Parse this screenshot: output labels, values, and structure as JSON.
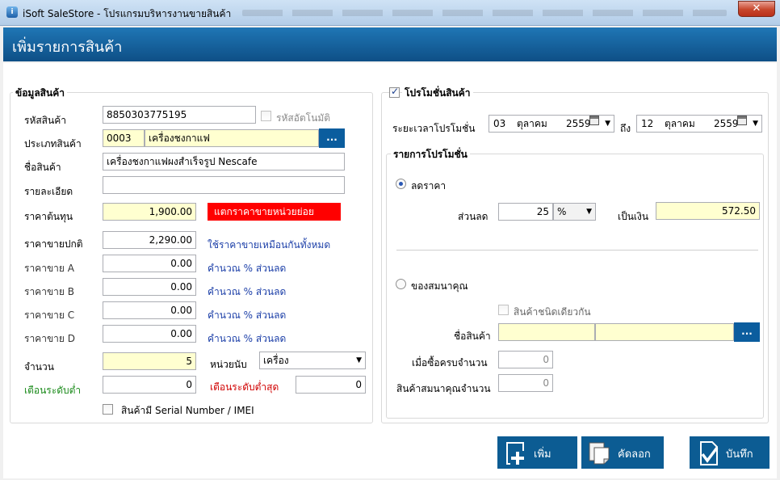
{
  "window": {
    "title": "iSoft SaleStore - โปรแกรมบริหารงานขายสินค้า",
    "close": "✕"
  },
  "page": {
    "heading": "เพิ่มรายการสินค้า"
  },
  "product": {
    "legend": "ข้อมูลสินค้า",
    "code_label": "รหัสสินค้า",
    "code_value": "8850303775195",
    "auto_code_label": "รหัสอัตโนมัติ",
    "category_label": "ประเภทสินค้า",
    "category_code": "0003",
    "category_name": "เครื่องชงกาแฟ",
    "browse": "...",
    "name_label": "ชื่อสินค้า",
    "name_value": "เครื่องชงกาแฟผงสำเร็จรูป Nescafe",
    "detail_label": "รายละเอียด",
    "detail_value": "",
    "cost_label": "ราคาต้นทุน",
    "cost_value": "1,900.00",
    "cost_warning": "แตกราคาขายหน่วยย่อย",
    "normal_price_label": "ราคาขายปกติ",
    "normal_price_value": "2,290.00",
    "same_price_link": "ใช้ราคาขายเหมือนกันทั้งหมด",
    "price_a_label": "ราคาขาย A",
    "price_a_value": "0.00",
    "price_b_label": "ราคาขาย B",
    "price_b_value": "0.00",
    "price_c_label": "ราคาขาย C",
    "price_c_value": "0.00",
    "price_d_label": "ราคาขาย D",
    "price_d_value": "0.00",
    "calc_discount_link": "คำนวณ % ส่วนลด",
    "qty_label": "จำนวน",
    "qty_value": "5",
    "unit_label": "หน่วยนับ",
    "unit_value": "เครื่อง",
    "min_alert_label": "เตือนระดับต่ำ",
    "min_alert_value": "0",
    "min_lowest_label": "เตือนระดับต่ำสุด",
    "min_lowest_value": "0",
    "serial_label": "สินค้ามี Serial Number / IMEI"
  },
  "promotion": {
    "legend": "โปรโมชั่นสินค้า",
    "period_label": "ระยะเวลาโปรโมชั่น",
    "from_day": "03",
    "from_month": "ตุลาคม",
    "from_year": "2559",
    "to_label": "ถึง",
    "to_day": "12",
    "to_month": "ตุลาคม",
    "to_year": "2559",
    "list_legend": "รายการโปรโมชั่น",
    "discount_option": "ลดราคา",
    "discount_label": "ส่วนลด",
    "discount_value": "25",
    "discount_unit": "%",
    "as_money_label": "เป็นเงิน",
    "as_money_value": "572.50",
    "gift_option": "ของสมนาคุณ",
    "same_item_label": "สินค้าชนิดเดียวกัน",
    "gift_product_label": "ชื่อสินค้า",
    "gift_browse": "...",
    "when_buy_label": "เมื่อซื้อครบจำนวน",
    "when_buy_value": "0",
    "gift_qty_label": "สินค้าสมนาคุณจำนวน",
    "gift_qty_value": "0"
  },
  "actions": {
    "add": "เพิ่ม",
    "copy": "คัดลอก",
    "save": "บันทึก"
  }
}
